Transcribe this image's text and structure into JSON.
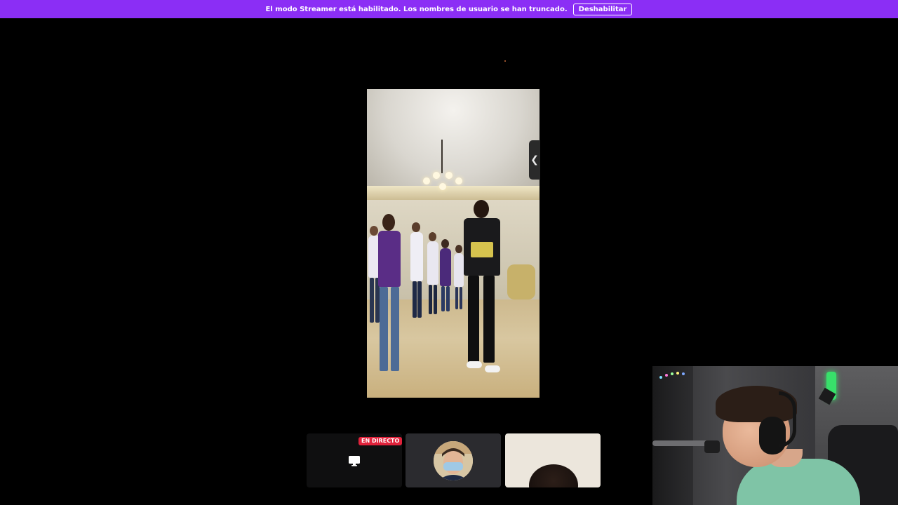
{
  "banner": {
    "message": "El modo Streamer está habilitado. Los nombres de usuario se han truncado.",
    "disable_label": "Deshabilitar",
    "background": "#8b2ef5"
  },
  "main_video": {
    "collapse_icon": "chevron-left-icon",
    "collapse_glyph": "❮"
  },
  "participants": [
    {
      "type": "screen-share",
      "badge": "EN DIRECTO",
      "badge_color": "#e0223b",
      "icon": "screen-share-icon"
    },
    {
      "type": "avatar",
      "icon": "user-avatar"
    },
    {
      "type": "camera",
      "icon": "camera-feed"
    }
  ],
  "webcam": {
    "accent_shirt": "#7fc4a6",
    "accent_light": "#38e06a"
  }
}
